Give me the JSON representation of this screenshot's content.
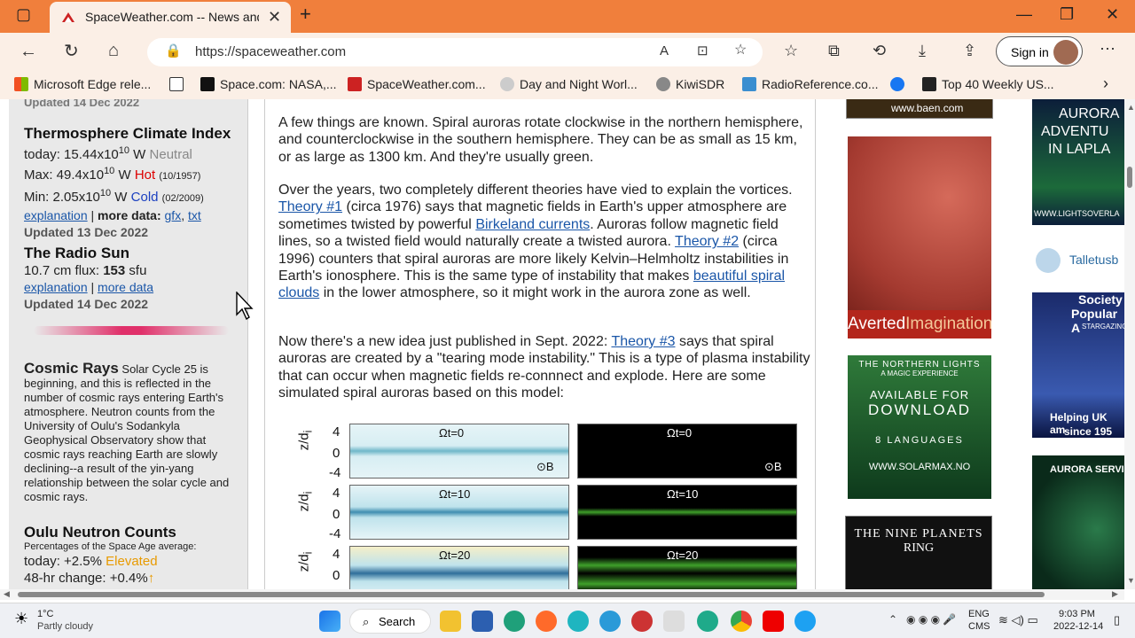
{
  "browser": {
    "tab_title": "SpaceWeather.com -- News and",
    "url": "https://spaceweather.com",
    "sign_in": "Sign in",
    "favorites": [
      {
        "label": "Microsoft Edge rele..."
      },
      {
        "label": "Space.com: NASA,..."
      },
      {
        "label": "SpaceWeather.com..."
      },
      {
        "label": "Day and Night Worl..."
      },
      {
        "label": "KiwiSDR"
      },
      {
        "label": "RadioReference.co..."
      },
      {
        "label": "Top 40 Weekly US..."
      }
    ]
  },
  "left": {
    "cut_top": "Updated 14 Dec 2022",
    "thermo": {
      "title": "Thermosphere Climate Index",
      "today_prefix": "today: 15.44x10",
      "exp": "10",
      "unit": " W ",
      "today_state": "Neutral",
      "max_prefix": "Max: 49.4x10",
      "max_state": "Hot",
      "max_date": "(10/1957)",
      "min_prefix": "Min: 2.05x10",
      "min_state": "Cold",
      "min_date": "(02/2009)",
      "explanation": "explanation",
      "sep": " | ",
      "more": "more data:",
      "gfx": "gfx",
      "txt": "txt",
      "updated": "Updated 13 Dec 2022"
    },
    "radio": {
      "title": "The Radio Sun",
      "flux_label": "10.7 cm flux: ",
      "flux_value": "153",
      "flux_unit": " sfu",
      "explanation": "explanation",
      "more": "more data",
      "updated": "Updated 14 Dec 2022"
    },
    "cosmic": {
      "title": "Cosmic Rays",
      "text": " Solar Cycle 25 is beginning, and this is reflected in the number of cosmic rays entering Earth's atmosphere. Neutron counts from the University of Oulu's Sodankyla Geophysical Observatory show that cosmic rays reaching Earth are slowly declining--a result of the yin-yang relationship between the solar cycle and cosmic rays."
    },
    "oulu": {
      "title": "Oulu Neutron Counts",
      "sub": "Percentages of the Space Age average:",
      "today_label": "today: +2.5% ",
      "today_state": "Elevated",
      "change": "48-hr change: +0.4%"
    }
  },
  "article": {
    "p1": "A few things are known. Spiral auroras rotate clockwise in the northern hemisphere, and counterclockwise in the southern hemisphere. They can be as small as 15 km, or as large as 1300 km. And they're usually green.",
    "p2": {
      "a": "Over the years, two completely different theories have vied to explain the vortices. ",
      "link1": "Theory #1",
      "b": " (circa 1976) says that magnetic fields in Earth's upper atmosphere are sometimes twisted by powerful ",
      "link2": "Birkeland currents",
      "c": ". Auroras follow magnetic field lines, so a twisted field would naturally create a twisted aurora. ",
      "link3": "Theory #2",
      "d": " (circa 1996) counters that spiral auroras are more likely Kelvin–Helmholtz instabilities in Earth's ionosphere. This is the same type of instability that makes ",
      "link4": "beautiful spiral clouds",
      "e": " in the lower atmosphere, so it might work in the aurora zone as well."
    },
    "p3": {
      "a": "Now there's a new idea just published in Sept. 2022: ",
      "link": "Theory #3",
      "b": " says that spiral auroras are created by a \"tearing mode instability.\" This is a type of plasma instability that can occur when magnetic fields re-connnect and explode. Here are some simulated spiral auroras based on this model:"
    },
    "figure": {
      "ylabel": "z/d",
      "ysub": "i",
      "ticks": [
        "4",
        "0",
        "-4"
      ],
      "rows": [
        "Ωt=0",
        "Ωt=10",
        "Ωt=20"
      ],
      "bg": "⊙B"
    }
  },
  "ads": {
    "averted": "Averted",
    "averted2": "Imagination",
    "northern1": "THE NORTHERN LIGHTS",
    "northern2": "A MAGIC EXPERIENCE",
    "avail1": "AVAILABLE FOR",
    "avail2": "DOWNLOAD",
    "langs": "8 LANGUAGES",
    "solarmax": "WWW.SOLARMAX.NO",
    "nine1": "THE NINE PLANETS",
    "nine2": "RING",
    "baen": "www.baen.com",
    "aurora1": "AURORA",
    "aurora2": "ADVENTU",
    "aurora3": "IN LAPLA",
    "lightsover": "WWW.LIGHTSOVERLA",
    "talletus": "Talletusb",
    "society1": "Society",
    "society2": "Popular A",
    "society3": "STARGAZING",
    "helping1": "Helping UK am",
    "helping2": "since 195",
    "service": "AURORA SERVI"
  },
  "taskbar": {
    "temp": "1°C",
    "weather": "Partly cloudy",
    "search": "Search",
    "lang1": "ENG",
    "lang2": "CMS",
    "time": "9:03 PM",
    "date": "2022-12-14"
  }
}
